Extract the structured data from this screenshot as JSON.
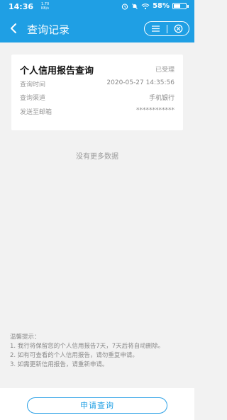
{
  "status_bar": {
    "time": "14:36",
    "speed_value": "1.70",
    "speed_unit": "KB/s",
    "battery": "58%",
    "battery_level": 0.58
  },
  "navbar": {
    "title": "查询记录"
  },
  "record": {
    "title": "个人信用报告查询",
    "status": "已受理",
    "rows": [
      {
        "label": "查询时间",
        "value": "2020-05-27 14:35:56"
      },
      {
        "label": "查询渠道",
        "value": "手机银行"
      },
      {
        "label": "发送至邮箱",
        "value": "************"
      }
    ]
  },
  "empty_text": "没有更多数据",
  "tips": {
    "heading": "温馨提示：",
    "items": [
      "1. 我行将保留您的个人信用报告7天，7天后将自动删除。",
      "2. 如有可查看的个人信用报告，请勿重复申请。",
      "3. 如需更新信用报告，请重新申请。"
    ]
  },
  "apply_button": "申请查询",
  "colors": {
    "header": "#1f9fe4",
    "background": "#f2f2f2",
    "accent": "#1f9fe4"
  }
}
